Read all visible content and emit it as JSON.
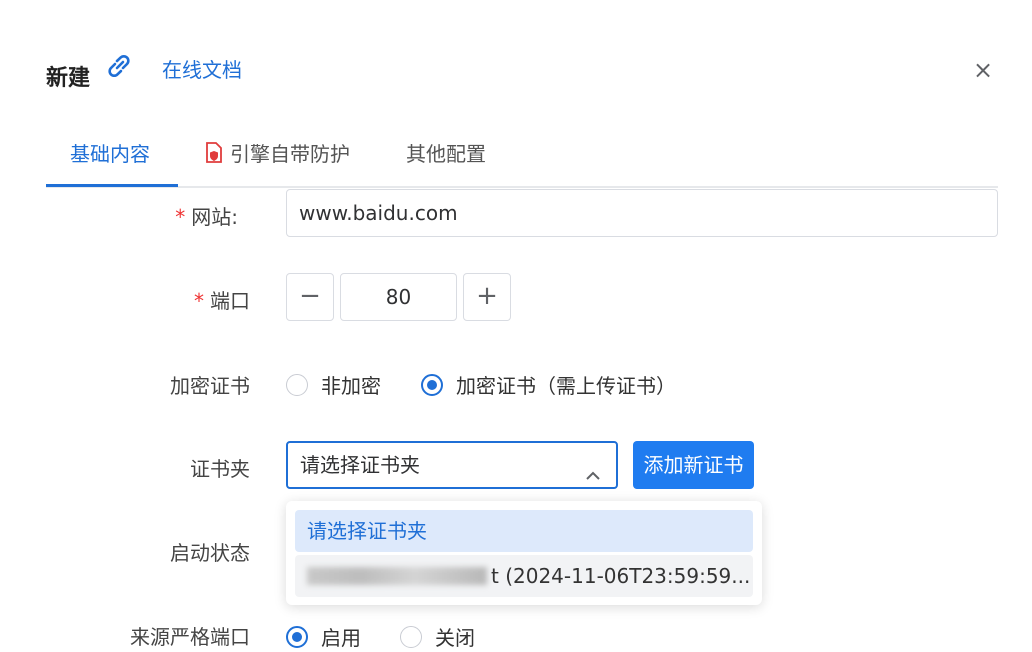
{
  "header": {
    "title": "新建",
    "online_doc": "在线文档",
    "close": "×"
  },
  "tabs": [
    {
      "label": "基础内容",
      "active": true
    },
    {
      "label": "引擎自带防护",
      "active": false
    },
    {
      "label": "其他配置",
      "active": false
    }
  ],
  "form": {
    "website": {
      "label": "网站:",
      "required": true,
      "value": "www.baidu.com"
    },
    "port": {
      "label": "端口",
      "required": true,
      "value": "80",
      "minus": "−",
      "plus": "+"
    },
    "encryption": {
      "label": "加密证书",
      "options": [
        {
          "label": "非加密",
          "checked": false
        },
        {
          "label": "加密证书（需上传证书）",
          "checked": true
        }
      ]
    },
    "cert_folder": {
      "label": "证书夹",
      "placeholder": "请选择证书夹",
      "add_button": "添加新证书",
      "dropdown_open": true,
      "options": [
        {
          "label": "请选择证书夹",
          "selected": true
        },
        {
          "label": "t (2024-11-06T23:59:59...",
          "redacted_prefix": true
        }
      ]
    },
    "startup_status": {
      "label": "启动状态"
    },
    "strict_source_port": {
      "label": "来源严格端口",
      "options": [
        {
          "label": "启用",
          "checked": true
        },
        {
          "label": "关闭",
          "checked": false
        }
      ]
    }
  },
  "colors": {
    "accent": "#1f6fd6",
    "button": "#1f7cf0",
    "required": "#e33333"
  }
}
